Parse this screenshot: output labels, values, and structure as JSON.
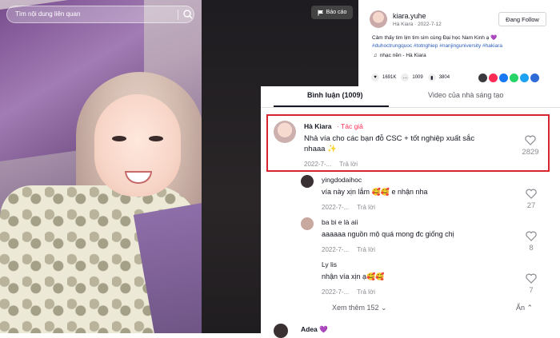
{
  "search": {
    "placeholder": "Tìm nội dung liên quan",
    "icon": "search-icon"
  },
  "report": {
    "label": "Báo cáo",
    "icon": "flag-icon"
  },
  "author": {
    "username": "kiara.yuhe",
    "display": "Hà Kiara · 2022-7-12",
    "follow_label": "Đang Follow",
    "description": "Cảm thấy tim lịm tim sim cùng Đại học Nam Kinh ạ 💜",
    "tags": "#duhoctrungquoc #totnghiep #nanjinguniversity #hakiara",
    "music": "nhạc nền - Hà Kiara"
  },
  "stats": {
    "likes": "1691K",
    "comments": "1009",
    "saves": "3804"
  },
  "share_colors": [
    "#3a3a3e",
    "#fe2c55",
    "#1877f2",
    "#25d366",
    "#1da1f2",
    "#2f6bd6"
  ],
  "tabs": {
    "comments_label": "Bình luận (1009)",
    "creator_videos_label": "Video của nhà sáng tạo"
  },
  "comments": [
    {
      "name": "Hà Kiara",
      "badge": "· Tác giả",
      "text_1": "Nhả vía cho các bạn đỗ CSC + tốt nghiệp xuất sắc",
      "text_2": "nhaaa ✨",
      "date": "2022-7-...",
      "reply": "Trả lời",
      "likes": "2829"
    },
    {
      "name": "yingdodaihoc",
      "text": "vía này xịn lắm 🥰🥰 e nhận nha",
      "date": "2022-7-...",
      "reply": "Trả lời",
      "likes": "27"
    },
    {
      "name": "ba bi e là aii",
      "text": "aaaaaa nguồn mộ quá mong đc giống chị",
      "date": "2022-7-...",
      "reply": "Trả lời",
      "likes": "8"
    },
    {
      "name": "Ly lis",
      "text": "nhận vía xịn ạ🥰🥰",
      "date": "2022-7-...",
      "reply": "Trả lời",
      "likes": "7"
    }
  ],
  "more_label": "Xem thêm 152 ⌄",
  "hide_label": "Ẩn ⌃",
  "next_comment_name": "Adea 💜"
}
